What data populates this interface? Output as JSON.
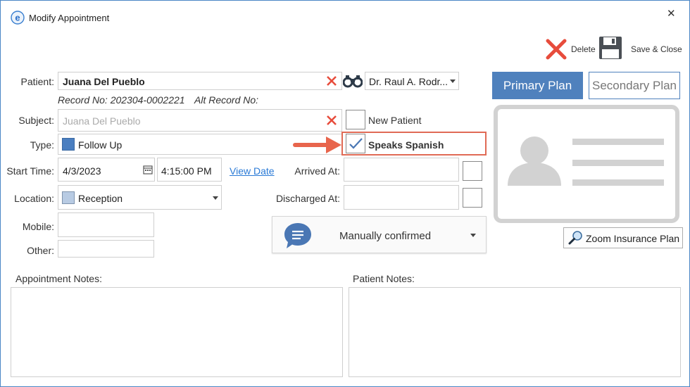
{
  "window": {
    "title": "Modify Appointment",
    "close_glyph": "✕"
  },
  "toolbar": {
    "delete_label": "Delete",
    "save_close_label": "Save & Close"
  },
  "patient": {
    "label": "Patient:",
    "value": "Juana Del Pueblo",
    "record_no": "Record No: 202304-0002221",
    "alt_record_no": "Alt Record No:"
  },
  "provider": {
    "value": "Dr. Raul A. Rodr..."
  },
  "subject": {
    "label": "Subject:",
    "placeholder": "Juana Del Pueblo"
  },
  "new_patient": {
    "label": "New Patient",
    "checked": false
  },
  "type": {
    "label": "Type:",
    "value": "Follow Up",
    "swatch_color": "#4a7ec0"
  },
  "speaks_spanish": {
    "label": "Speaks Spanish",
    "checked": true
  },
  "start": {
    "label": "Start Time:",
    "date": "4/3/2023",
    "time": "4:15:00 PM",
    "view_date_link": "View Date"
  },
  "arrived": {
    "label": "Arrived At:"
  },
  "location": {
    "label": "Location:",
    "value": "Reception",
    "swatch_color": "#b8cbe3"
  },
  "discharged": {
    "label": "Discharged At:"
  },
  "mobile": {
    "label": "Mobile:"
  },
  "other": {
    "label": "Other:"
  },
  "confirmation": {
    "value": "Manually confirmed",
    "icon_color": "#4a77b4"
  },
  "plans": {
    "primary_label": "Primary Plan",
    "secondary_label": "Secondary Plan",
    "primary_color": "#4f81bd"
  },
  "zoom_insurance_label": "Zoom Insurance Plan",
  "appointment_notes": {
    "label": "Appointment Notes:"
  },
  "patient_notes": {
    "label": "Patient Notes:"
  },
  "colors": {
    "accent_red": "#e74c3c",
    "highlight_border": "#e06a55",
    "link_blue": "#2a7ad6"
  }
}
